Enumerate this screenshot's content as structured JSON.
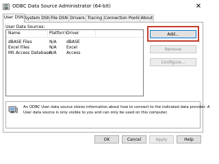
{
  "window": {
    "title": "ODBC Data Source Administrator (64-bit)",
    "close_glyph": "✕"
  },
  "tabs": [
    {
      "label": "User DSN"
    },
    {
      "label": "System DSN"
    },
    {
      "label": "File DSN"
    },
    {
      "label": "Drivers"
    },
    {
      "label": "Tracing"
    },
    {
      "label": "Connection Pooling"
    },
    {
      "label": "About"
    }
  ],
  "main": {
    "sources_label": "User Data Sources:",
    "columns": {
      "name": "Name",
      "platform": "Platform",
      "driver": "Driver"
    },
    "rows": [
      {
        "name": "dBASE Files",
        "platform": "N/A",
        "driver": "dBASE"
      },
      {
        "name": "Excel Files",
        "platform": "N/A",
        "driver": "Excel"
      },
      {
        "name": "MS Access Database",
        "platform": "N/A",
        "driver": "Access"
      }
    ],
    "buttons": {
      "add": "Add...",
      "remove": "Remove",
      "configure": "Configure..."
    },
    "info": {
      "line1": "An ODBC User data source stores information about how to connect to the indicated data provider.  A",
      "line2": "User data source is only visible to you and can only be used on this computer."
    }
  },
  "footer": {
    "ok": "OK",
    "cancel": "Cancel",
    "apply": "Apply",
    "help": "Help"
  },
  "colors": {
    "highlight": "#c0392b",
    "accent": "#0078d7"
  }
}
